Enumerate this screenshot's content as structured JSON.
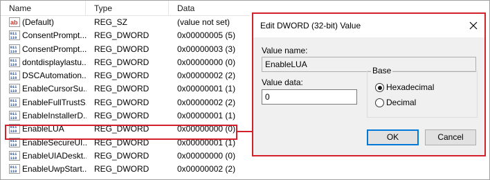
{
  "registry": {
    "columns": {
      "name": "Name",
      "type": "Type",
      "data": "Data"
    },
    "rows": [
      {
        "name": "(Default)",
        "type": "REG_SZ",
        "data": "(value not set)",
        "icon": "string-value-icon"
      },
      {
        "name": "ConsentPrompt...",
        "type": "REG_DWORD",
        "data": "0x00000005 (5)",
        "icon": "binary-value-icon"
      },
      {
        "name": "ConsentPrompt...",
        "type": "REG_DWORD",
        "data": "0x00000003 (3)",
        "icon": "binary-value-icon"
      },
      {
        "name": "dontdisplaylastu...",
        "type": "REG_DWORD",
        "data": "0x00000000 (0)",
        "icon": "binary-value-icon"
      },
      {
        "name": "DSCAutomation...",
        "type": "REG_DWORD",
        "data": "0x00000002 (2)",
        "icon": "binary-value-icon"
      },
      {
        "name": "EnableCursorSu...",
        "type": "REG_DWORD",
        "data": "0x00000001 (1)",
        "icon": "binary-value-icon"
      },
      {
        "name": "EnableFullTrustS...",
        "type": "REG_DWORD",
        "data": "0x00000002 (2)",
        "icon": "binary-value-icon"
      },
      {
        "name": "EnableInstallerD...",
        "type": "REG_DWORD",
        "data": "0x00000001 (1)",
        "icon": "binary-value-icon"
      },
      {
        "name": "EnableLUA",
        "type": "REG_DWORD",
        "data": "0x00000000 (0)",
        "icon": "binary-value-icon"
      },
      {
        "name": "EnableSecureUI...",
        "type": "REG_DWORD",
        "data": "0x00000001 (1)",
        "icon": "binary-value-icon"
      },
      {
        "name": "EnableUIADeskt...",
        "type": "REG_DWORD",
        "data": "0x00000000 (0)",
        "icon": "binary-value-icon"
      },
      {
        "name": "EnableUwpStart...",
        "type": "REG_DWORD",
        "data": "0x00000002 (2)",
        "icon": "binary-value-icon"
      }
    ],
    "highlight_color": "#d4202a"
  },
  "dialog": {
    "title": "Edit DWORD (32-bit) Value",
    "value_name_label": "Value name:",
    "value_name": "EnableLUA",
    "value_data_label": "Value data:",
    "value_data": "0",
    "base_label": "Base",
    "hex_label": "Hexadecimal",
    "dec_label": "Decimal",
    "ok_label": "OK",
    "cancel_label": "Cancel",
    "selected_base": "Hexadecimal",
    "accent_color": "#0078d7"
  }
}
